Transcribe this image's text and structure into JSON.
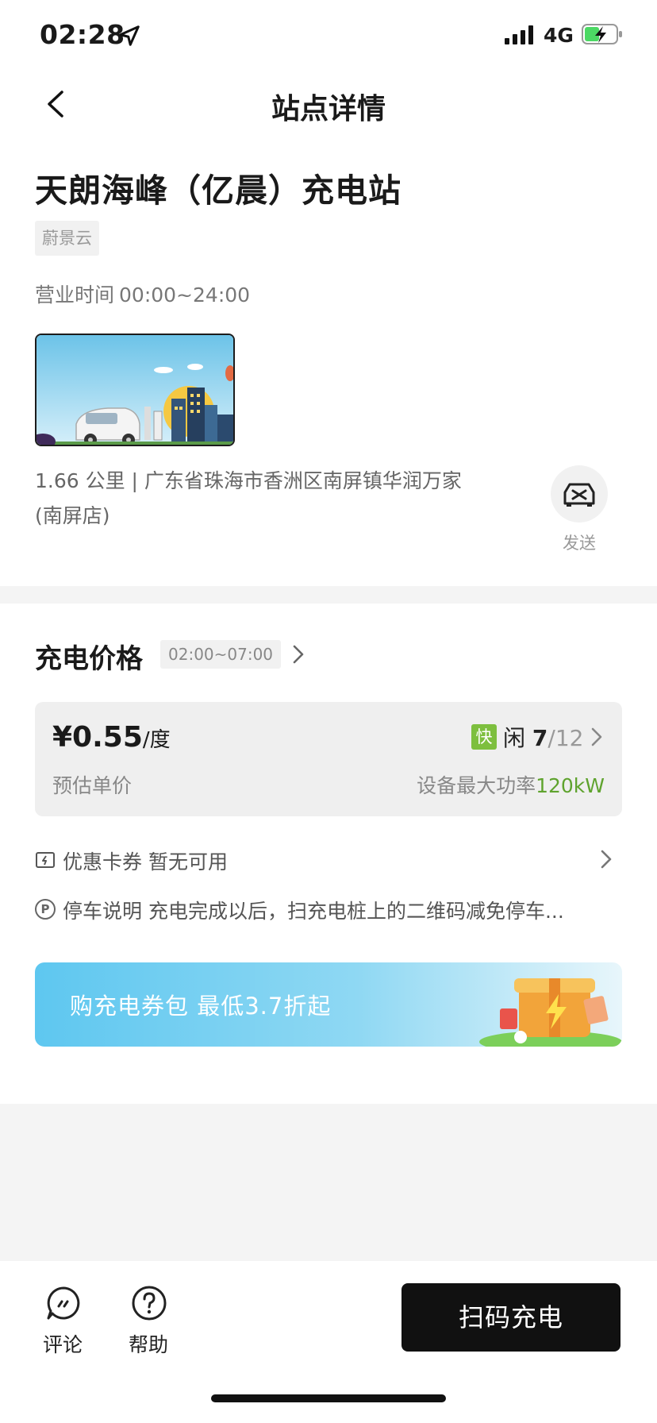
{
  "status_bar": {
    "time": "02:28",
    "network": "4G"
  },
  "nav": {
    "title": "站点详情"
  },
  "station": {
    "name": "天朗海峰（亿晨）充电站",
    "tag": "蔚景云",
    "hours_label": "营业时间",
    "hours_value": "00:00~24:00",
    "address_line1": "1.66 公里 | 广东省珠海市香洲区南屏镇华润万家",
    "address_line2": "(南屏店)",
    "send_label": "发送"
  },
  "price": {
    "title": "充电价格",
    "time_range": "02:00~07:00",
    "price_value": "¥0.55",
    "price_unit": "/度",
    "price_label": "预估单价",
    "fast_badge": "快",
    "idle_label": "闲 ",
    "idle_count": "7",
    "total_count": "/12",
    "power_label": "设备最大功率",
    "power_value": "120kW"
  },
  "coupon": {
    "text": "优惠卡券 暂无可用"
  },
  "parking": {
    "icon": "P",
    "text": "停车说明 充电完成以后，扫充电桩上的二维码减免停车..."
  },
  "banner": {
    "text": "购充电券包 最低3.7折起"
  },
  "bottom": {
    "comment_label": "评论",
    "help_label": "帮助",
    "scan_label": "扫码充电"
  },
  "colors": {
    "accent_green": "#5fa32e",
    "fast_badge": "#7dbf3e",
    "primary_button": "#111111",
    "banner_blue": "#5ec7f0"
  },
  "icons": [
    "location-arrow-icon",
    "signal-icon",
    "battery-charging-icon",
    "back-chevron-icon",
    "car-send-icon",
    "chevron-right-icon",
    "coupon-icon",
    "parking-icon",
    "comment-icon",
    "help-icon"
  ]
}
